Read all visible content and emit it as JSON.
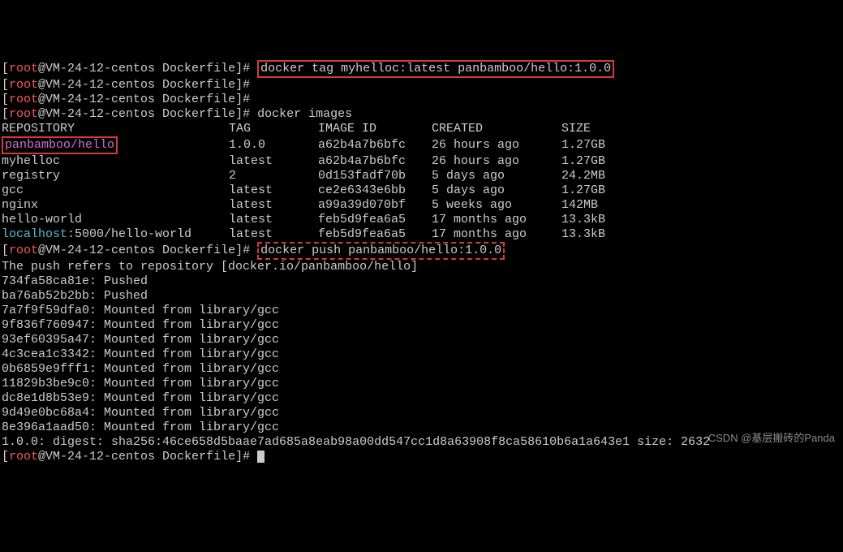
{
  "prompt": {
    "user": "root",
    "at": "@",
    "host": "VM-24-12-centos",
    "cwd": "Dockerfile",
    "symbol": "#"
  },
  "commands": {
    "tag": "docker tag myhelloc:latest panbamboo/hello:1.0.0",
    "images": "docker images",
    "push": "docker push panbamboo/hello:1.0.0"
  },
  "table": {
    "headers": {
      "repo": "REPOSITORY",
      "tag": "TAG",
      "id": "IMAGE ID",
      "created": "CREATED",
      "size": "SIZE"
    },
    "rows": [
      {
        "repo": "panbamboo/hello",
        "tag": "1.0.0",
        "id": "a62b4a7b6bfc",
        "created": "26 hours ago",
        "size": "1.27GB",
        "repo_hl": "magenta",
        "repo_box": true
      },
      {
        "repo": "myhelloc",
        "tag": "latest",
        "id": "a62b4a7b6bfc",
        "created": "26 hours ago",
        "size": "1.27GB"
      },
      {
        "repo": "registry",
        "tag": "2",
        "id": "0d153fadf70b",
        "created": "5 days ago",
        "size": "24.2MB"
      },
      {
        "repo": "gcc",
        "tag": "latest",
        "id": "ce2e6343e6bb",
        "created": "5 days ago",
        "size": "1.27GB"
      },
      {
        "repo": "nginx",
        "tag": "latest",
        "id": "a99a39d070bf",
        "created": "5 weeks ago",
        "size": "142MB"
      },
      {
        "repo": "hello-world",
        "tag": "latest",
        "id": "feb5d9fea6a5",
        "created": "17 months ago",
        "size": "13.3kB"
      },
      {
        "repo_prefix": "localhost",
        "repo_suffix": ":5000/hello-world",
        "tag": "latest",
        "id": "feb5d9fea6a5",
        "created": "17 months ago",
        "size": "13.3kB"
      }
    ]
  },
  "push_output": {
    "refers": "The push refers to repository [docker.io/panbamboo/hello]",
    "layers": [
      {
        "id": "734fa58ca81e",
        "status": "Pushed"
      },
      {
        "id": "ba76ab52b2bb",
        "status": "Pushed"
      },
      {
        "id": "7a7f9f59dfa0",
        "status": "Mounted from library/gcc"
      },
      {
        "id": "9f836f760947",
        "status": "Mounted from library/gcc"
      },
      {
        "id": "93ef60395a47",
        "status": "Mounted from library/gcc"
      },
      {
        "id": "4c3cea1c3342",
        "status": "Mounted from library/gcc"
      },
      {
        "id": "0b6859e9fff1",
        "status": "Mounted from library/gcc"
      },
      {
        "id": "11829b3be9c0",
        "status": "Mounted from library/gcc"
      },
      {
        "id": "dc8e1d8b53e9",
        "status": "Mounted from library/gcc"
      },
      {
        "id": "9d49e0bc68a4",
        "status": "Mounted from library/gcc"
      },
      {
        "id": "8e396a1aad50",
        "status": "Mounted from library/gcc"
      }
    ],
    "digest": "1.0.0: digest: sha256:46ce658d5baae7ad685a8eab98a00dd547cc1d8a63908f8ca58610b6a1a643e1 size: 2632"
  },
  "watermark": "CSDN @基层搬砖的Panda"
}
